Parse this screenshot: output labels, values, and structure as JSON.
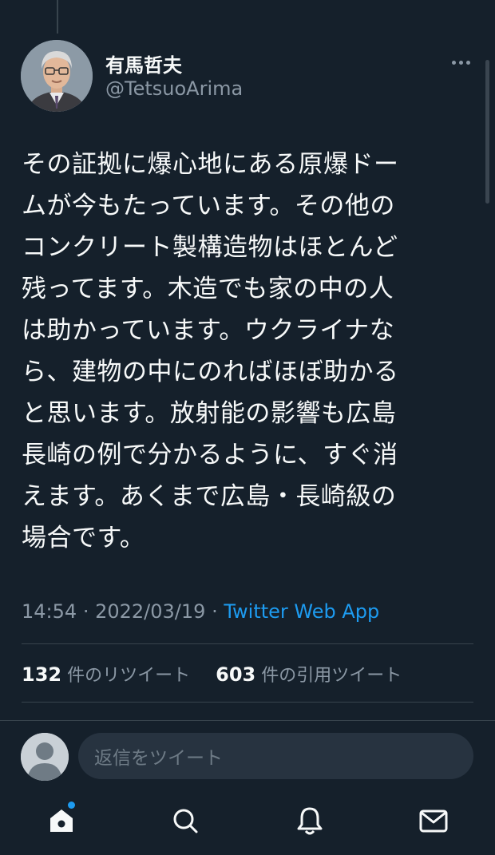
{
  "tweet": {
    "author": {
      "name": "有馬哲夫",
      "handle": "@TetsuoArima"
    },
    "text_lines": [
      "その証拠に爆心地にある原爆ドー",
      "ムが今もたっています。その他の",
      "コンクリート製構造物はほとんど",
      "残ってます。木造でも家の中の人",
      "は助かっています。ウクライナな",
      "ら、建物の中にのればほぼ助かる",
      "と思います。放射能の影響も広島",
      "長崎の例で分かるように、すぐ消",
      "えます。あくまで広島・長崎級の",
      "場合です。"
    ],
    "time": "14:54",
    "separator": "·",
    "date": "2022/03/19",
    "source": "Twitter Web App",
    "retweets": {
      "count": "132",
      "label": "件のリツイート"
    },
    "quotes": {
      "count": "603",
      "label": "件の引用ツイート"
    }
  },
  "reply": {
    "placeholder": "返信をツイート"
  },
  "tabbar": {
    "items": [
      {
        "icon": "home-icon",
        "has_badge": true
      },
      {
        "icon": "search-icon"
      },
      {
        "icon": "bell-icon"
      },
      {
        "icon": "mail-icon"
      }
    ]
  },
  "colors": {
    "background": "#15202b",
    "accent": "#1d9bf0",
    "secondary_text": "#8b98a5",
    "divider": "#38444d"
  }
}
